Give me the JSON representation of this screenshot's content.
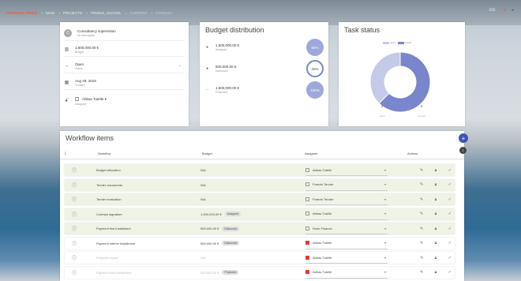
{
  "breadcrumb": {
    "project": "PAMIGNET (TEST)",
    "items": [
      "MAIN",
      "PROJECTS",
      "PRIMUS_SCHOOL",
      "CURRENT",
      "CONSULT"
    ]
  },
  "topright": {
    "text": "EN"
  },
  "project": {
    "name": "Consultancy supervision",
    "desc": "No description",
    "budget": "1,600,000.00 €",
    "budget_label": "Budget",
    "status": "Open",
    "status_label": "Status",
    "created": "Aug 28, 2019",
    "created_label": "Created",
    "assignee": "Abbas Tutelle",
    "assignee_label": "Assignee"
  },
  "budget": {
    "title": "Budget distribution",
    "rows": [
      {
        "value": "1,500,000.00 €",
        "label": "Assigned",
        "pct": "94%",
        "color": "#7986cb"
      },
      {
        "value": "500,000.00 €",
        "label": "Disbursed",
        "pct": "33%",
        "color": "#ffffff"
      },
      {
        "value": "1,500,000.00 €",
        "label": "Projected",
        "pct": "100%",
        "color": "#9fa8da"
      }
    ]
  },
  "task": {
    "title": "Task status",
    "legend": [
      {
        "name": "open",
        "color": "#c5cae9"
      },
      {
        "name": "closed",
        "color": "#7986cb"
      }
    ],
    "counts": [
      {
        "n": "3",
        "l": "Open"
      },
      {
        "n": "5",
        "l": "Closed"
      }
    ]
  },
  "chart_data": {
    "type": "pie",
    "categories": [
      "open",
      "closed"
    ],
    "values": [
      3,
      5
    ],
    "colors": [
      "#c5cae9",
      "#7986cb"
    ]
  },
  "workflow": {
    "title": "Workflow items",
    "headers": {
      "workflow": "Workflow",
      "budget": "Budget",
      "assignee": "Assignee",
      "actions": "Actions"
    },
    "rows": [
      {
        "name": "Budget allocation",
        "budget": "N/A",
        "badge": "",
        "assignee": "Abbas Tutelle",
        "state": "done"
      },
      {
        "name": "Tender documents",
        "budget": "N/A",
        "badge": "",
        "assignee": "Francis Tender",
        "state": "done"
      },
      {
        "name": "Tender evaluation",
        "budget": "N/A",
        "badge": "",
        "assignee": "Francis Tender",
        "state": "done"
      },
      {
        "name": "Contract signature",
        "budget": "1,000,000.00 €",
        "badge": "Assigned",
        "assignee": "Abbas Tutelle",
        "state": "done"
      },
      {
        "name": "Payment first installment",
        "budget": "500,000.00 €",
        "badge": "Disbursed",
        "assignee": "Rose Finance",
        "state": "done"
      },
      {
        "name": "Payment interim installment",
        "budget": "500,000.00 €",
        "badge": "Disbursed",
        "assignee": "Abbas Tutelle",
        "state": "open"
      },
      {
        "name": "Progress report",
        "budget": "N/A",
        "badge": "",
        "assignee": "Abbas Tutelle",
        "state": "future"
      },
      {
        "name": "Payment final installment",
        "budget": "500,000.00 €",
        "badge": "Projected",
        "assignee": "Abbas Tutelle",
        "state": "future"
      }
    ]
  }
}
